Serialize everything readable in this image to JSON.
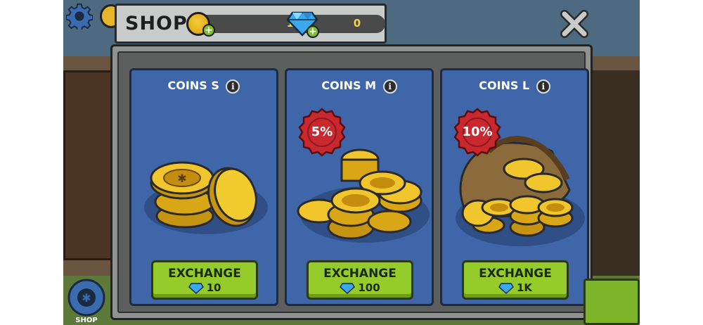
{
  "header": {
    "title": "SHOP",
    "coins_value": "11",
    "gems_value": "0"
  },
  "nav": {
    "shop_label": "SHOP"
  },
  "cards": [
    {
      "title": "COINS S",
      "discount": "",
      "exchange_label": "EXCHANGE",
      "price": "10"
    },
    {
      "title": "COINS M",
      "discount": "5%",
      "exchange_label": "EXCHANGE",
      "price": "100"
    },
    {
      "title": "COINS L",
      "discount": "10%",
      "exchange_label": "EXCHANGE",
      "price": "1K"
    }
  ],
  "icons": {
    "settings": "gear-icon",
    "close": "close-icon",
    "coin": "coin-icon",
    "gem": "diamond-icon",
    "add": "plus-icon",
    "info": "info-icon"
  },
  "colors": {
    "card_bg": "#3f66a8",
    "exchange_btn": "#95cc2c",
    "badge_red": "#c8282e",
    "gem_blue": "#3aa8ea",
    "coin_gold": "#e9b420"
  }
}
